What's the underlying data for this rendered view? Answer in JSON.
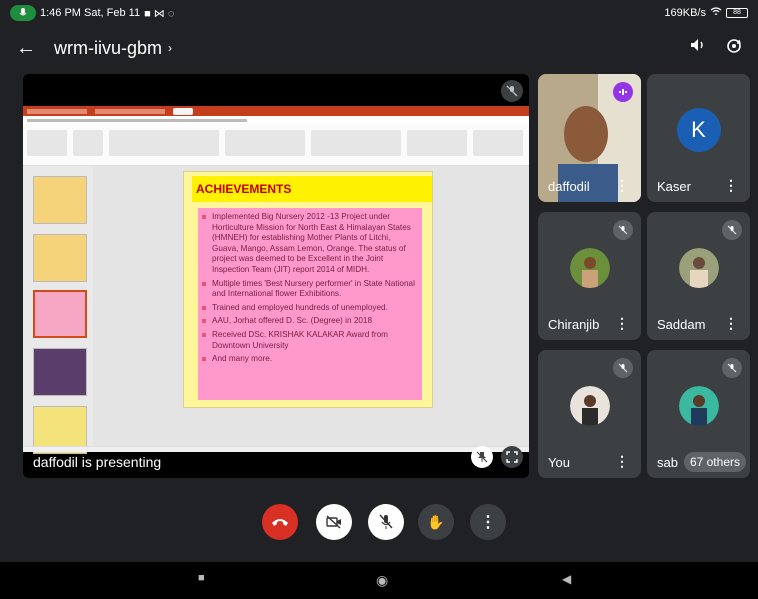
{
  "status_bar": {
    "time": "1:46 PM Sat, Feb 11",
    "indicators": "■ ⋈ ◌",
    "net_speed": "169KB/s",
    "battery": "88"
  },
  "header": {
    "meeting_title": "wrm-iivu-gbm",
    "chevron": "›"
  },
  "stage": {
    "presenter_label": "daffodil is presenting",
    "slide": {
      "heading": "ACHIEVEMENTS",
      "bullets": [
        "Implemented Big Nursery 2012 -13 Project under Horticulture Mission for North East & Himalayan States (HMNEH) for establishing Mother Plants of Litchi, Guava, Mango, Assam Lemon, Orange. The status of project was deemed to be Excellent in the Joint Inspection Team (JIT) report 2014 of MIDH.",
        "Multiple times 'Best Nursery performer' in State National and International flower Exhibitions.",
        "Trained and employed hundreds of unemployed.",
        "AAU, Jorhat offered D. Sc. (Degree) in 2018",
        "Received DSc. KRISHAK KALAKAR Award from Downtown University",
        "And many more."
      ]
    }
  },
  "participants": [
    {
      "name": "daffodil",
      "avatar": "photo"
    },
    {
      "name": "Kaser",
      "avatar_letter": "K"
    },
    {
      "name": "Chiranjib",
      "avatar": "photo"
    },
    {
      "name": "Saddam",
      "avatar": "photo"
    },
    {
      "name": "You",
      "avatar": "photo"
    },
    {
      "name": "sab",
      "avatar": "photo"
    }
  ],
  "others_count": "67 others",
  "colors": {
    "end_call": "#d93025",
    "mic_active": "#1e8e3e",
    "background": "#202124",
    "tile": "#3c4043"
  },
  "icons": {
    "back": "←",
    "volume": "🔈",
    "camera_switch": "⟳",
    "dots": "⋮",
    "muted": "🎤̸",
    "end_call": "☎",
    "camera_off": "▣",
    "hand": "✋",
    "nav_home": "◉",
    "nav_back": "◀",
    "nav_recent": "■"
  }
}
